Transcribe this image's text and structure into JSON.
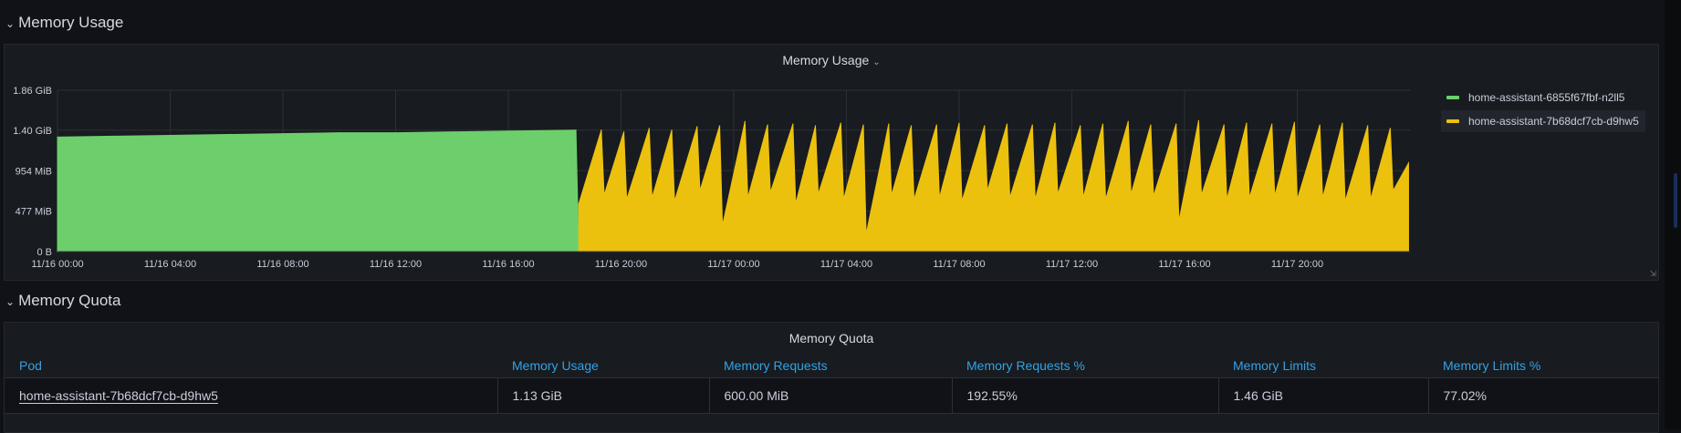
{
  "rows": {
    "memory_usage_row": "Memory Usage",
    "memory_quota_row": "Memory Quota"
  },
  "usage_panel": {
    "title": "Memory Usage"
  },
  "quota_panel": {
    "title": "Memory Quota",
    "columns": [
      "Pod",
      "Memory Usage",
      "Memory Requests",
      "Memory Requests %",
      "Memory Limits",
      "Memory Limits %"
    ],
    "rows": [
      [
        "home-assistant-7b68dcf7cb-d9hw5",
        "1.13 GiB",
        "600.00 MiB",
        "192.55%",
        "1.46 GiB",
        "77.02%"
      ]
    ]
  },
  "icons": {
    "row_toggle": "chevron-down-icon",
    "panel_menu": "chevron-down-icon",
    "resize": "resize-handle-icon"
  },
  "colors": {
    "series_green": "#6ccf6c",
    "series_yellow": "#ecc10e",
    "table_header": "#33a2e5"
  },
  "chart_data": {
    "type": "area",
    "title": "Memory Usage",
    "xlabel": "",
    "ylabel": "",
    "ylim": [
      0,
      1.86
    ],
    "y_unit": "GiB",
    "y_tick_labels": [
      "0 B",
      "477 MiB",
      "954 MiB",
      "1.40 GiB",
      "1.86 GiB"
    ],
    "y_tick_values": [
      0,
      0.466,
      0.932,
      1.4,
      1.86
    ],
    "x_range_hours": [
      0,
      48
    ],
    "x_tick_labels": [
      "11/16 00:00",
      "11/16 04:00",
      "11/16 08:00",
      "11/16 12:00",
      "11/16 16:00",
      "11/16 20:00",
      "11/17 00:00",
      "11/17 04:00",
      "11/17 08:00",
      "11/17 12:00",
      "11/17 16:00",
      "11/17 20:00"
    ],
    "legend_position": "right",
    "grid": true,
    "series": [
      {
        "name": "home-assistant-6855f67fbf-n2ll5",
        "color": "#6ccf6c",
        "x": [
          0,
          2,
          4,
          6,
          8,
          10,
          12,
          14,
          16,
          18.4,
          18.5
        ],
        "values": [
          1.32,
          1.33,
          1.34,
          1.35,
          1.36,
          1.37,
          1.37,
          1.38,
          1.39,
          1.4,
          0
        ]
      },
      {
        "name": "home-assistant-7b68dcf7cb-d9hw5",
        "color": "#ecc10e",
        "x": [
          18.5,
          19.3,
          19.4,
          20.1,
          20.2,
          21.0,
          21.1,
          21.8,
          21.9,
          22.7,
          22.8,
          23.5,
          23.6,
          24.4,
          24.5,
          25.2,
          25.3,
          26.1,
          26.2,
          26.9,
          27.0,
          27.8,
          27.9,
          28.6,
          28.7,
          29.5,
          29.6,
          30.3,
          30.4,
          31.2,
          31.3,
          32.0,
          32.1,
          32.9,
          33.0,
          33.7,
          33.8,
          34.6,
          34.7,
          35.4,
          35.5,
          36.3,
          36.4,
          37.1,
          37.2,
          38.0,
          38.1,
          38.8,
          38.9,
          39.7,
          39.8,
          40.5,
          40.6,
          41.4,
          41.5,
          42.2,
          42.3,
          43.1,
          43.2,
          43.9,
          44.0,
          44.8,
          44.9,
          45.6,
          45.7,
          46.5,
          46.6,
          47.3,
          47.4,
          47.95
        ],
        "values": [
          0.55,
          1.4,
          0.65,
          1.38,
          0.6,
          1.42,
          0.62,
          1.4,
          0.58,
          1.44,
          0.7,
          1.45,
          0.3,
          1.5,
          0.62,
          1.46,
          0.68,
          1.47,
          0.55,
          1.45,
          0.66,
          1.48,
          0.6,
          1.46,
          0.2,
          1.47,
          0.65,
          1.45,
          0.6,
          1.46,
          0.62,
          1.48,
          0.58,
          1.45,
          0.7,
          1.47,
          0.62,
          1.46,
          0.6,
          1.48,
          0.66,
          1.45,
          0.62,
          1.47,
          0.6,
          1.5,
          0.66,
          1.46,
          0.64,
          1.47,
          0.35,
          1.51,
          0.65,
          1.46,
          0.6,
          1.48,
          0.62,
          1.47,
          0.64,
          1.49,
          0.6,
          1.46,
          0.62,
          1.48,
          0.58,
          1.45,
          0.6,
          1.42,
          0.7,
          1.02
        ]
      }
    ]
  }
}
